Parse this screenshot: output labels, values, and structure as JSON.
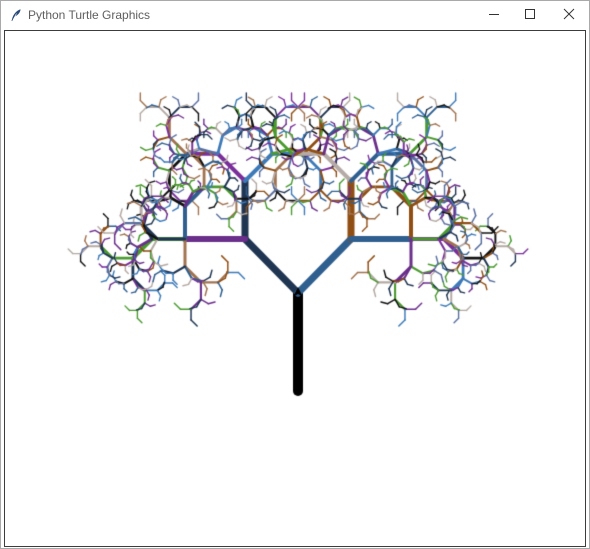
{
  "window": {
    "title": "Python Turtle Graphics",
    "controls": {
      "minimize": "minimize-icon",
      "maximize": "maximize-icon",
      "close": "close-icon"
    }
  },
  "canvas": {
    "background": "#ffffff",
    "trunk_color": "#000000",
    "turtle_marker": "turtle-cursor-icon",
    "palette": [
      "#1f3552",
      "#2f5f8f",
      "#3d7ab8",
      "#7a2f9a",
      "#8f4e13",
      "#a07350",
      "#4a9a2f",
      "#b5aaa5",
      "#111111",
      "#6a2f8a",
      "#5a6fa0"
    ]
  },
  "accents": {
    "window_edge": "#1a7fc0"
  }
}
